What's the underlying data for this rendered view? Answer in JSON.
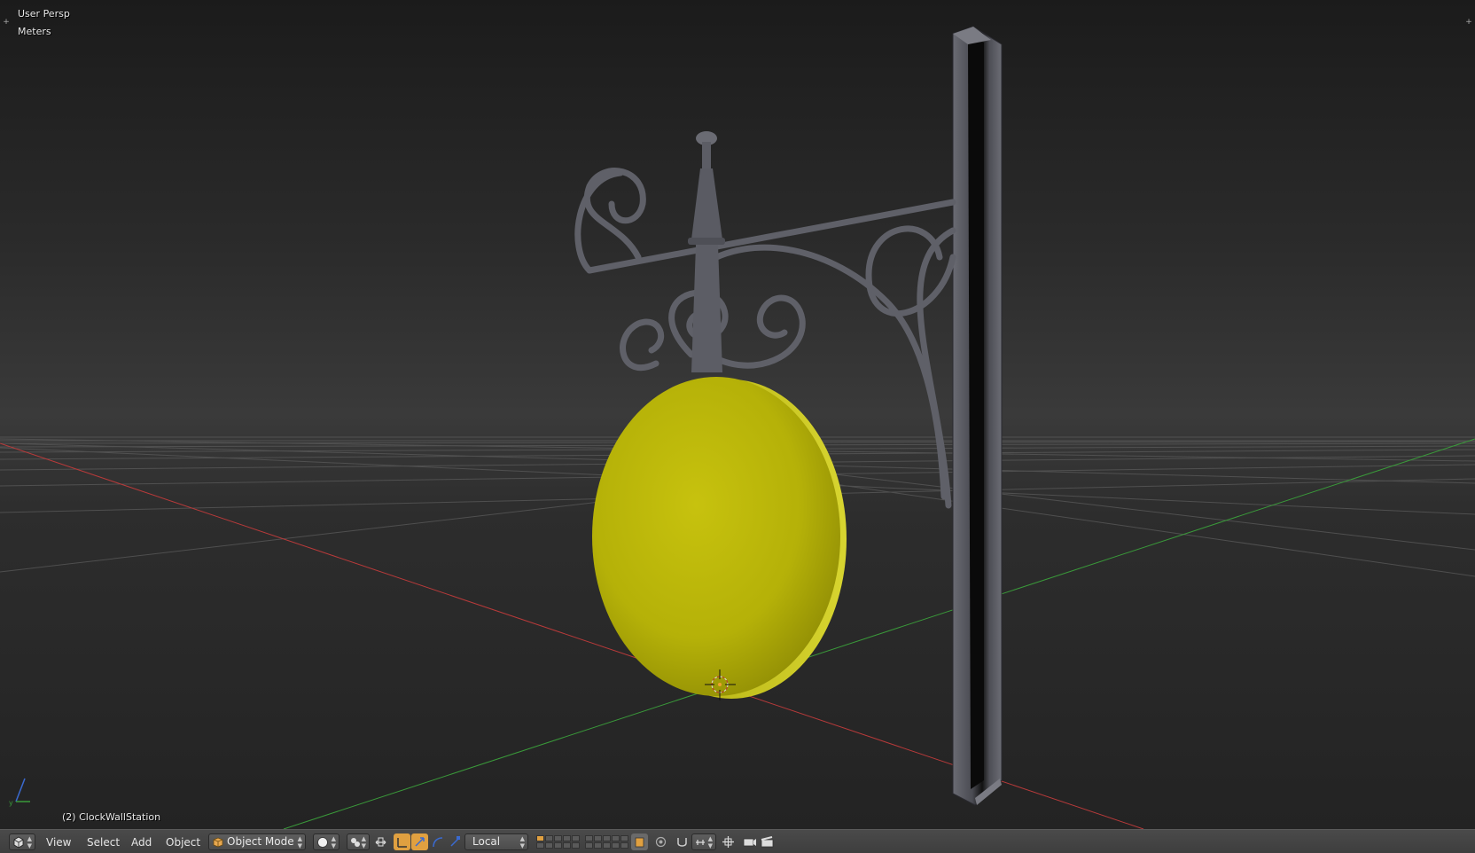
{
  "viewport": {
    "view_name": "User Persp",
    "units": "Meters",
    "active_object": "(2) ClockWallStation",
    "gizmo_y_label": "y"
  },
  "header": {
    "editor_type_icon": "3d-view-icon",
    "menus": [
      "View",
      "Select",
      "Add",
      "Object"
    ],
    "mode": "Object Mode",
    "mode_icon": "cube-icon",
    "shading_icon": "solid-sphere-icon",
    "pivot_icon": "pivot-point-icon",
    "transform_orientation": "Local",
    "manipulator_icons": [
      "translate-icon",
      "rotate-icon",
      "scale-icon"
    ]
  },
  "colors": {
    "clock_face": "#c9c510",
    "bracket_metal": "#5f6068",
    "x_axis": "#b83a3a",
    "y_axis": "#3a9a3a",
    "grid": "#5a5a5a",
    "accent": "#e0a040"
  }
}
